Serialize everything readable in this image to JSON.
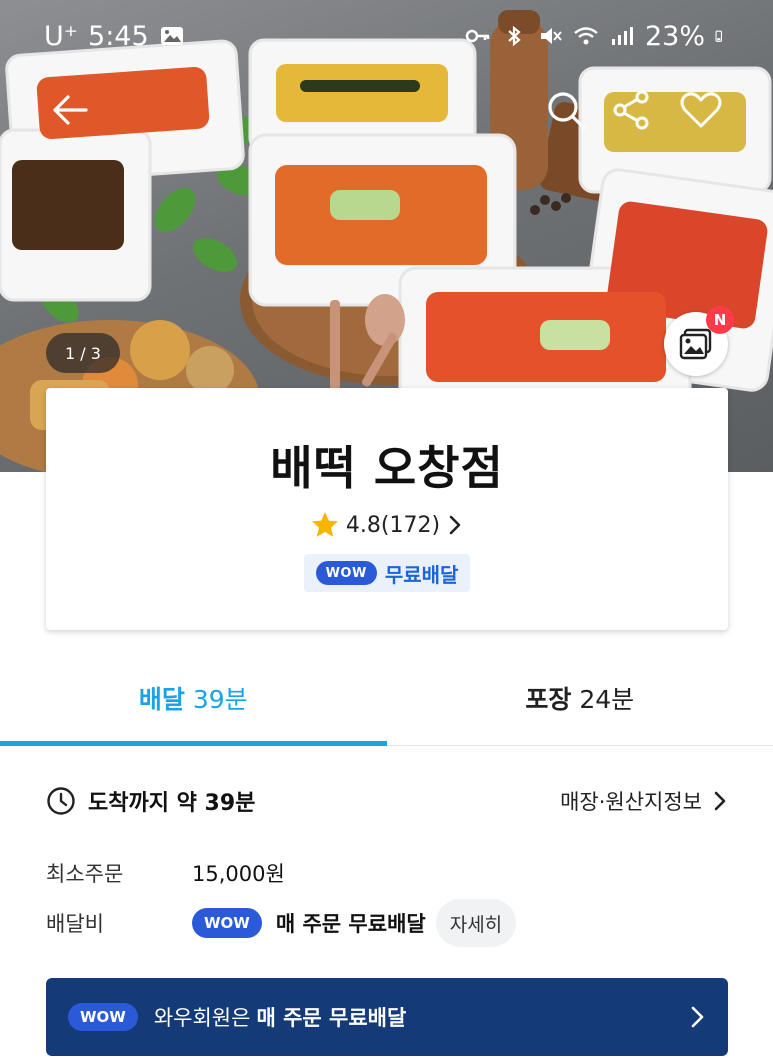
{
  "status_bar": {
    "carrier": "U⁺",
    "time": "5:45",
    "battery": "23%"
  },
  "hero": {
    "pager": "1 / 3",
    "photo_badge": "N"
  },
  "store": {
    "name": "배떡 오창점",
    "rating": "4.8(172)",
    "wow_label": "WOW",
    "free_delivery": "무료배달"
  },
  "tabs": [
    {
      "name": "배달",
      "time": "39분",
      "active": true
    },
    {
      "name": "포장",
      "time": "24분",
      "active": false
    }
  ],
  "arrival": {
    "text": "도착까지 약 39분",
    "origin_link": "매장·원산지정보"
  },
  "min_order": {
    "label": "최소주문",
    "value": "15,000원"
  },
  "delivery_fee": {
    "label": "배달비",
    "wow_label": "WOW",
    "value": "매 주문 무료배달",
    "detail_button": "자세히"
  },
  "wow_banner": {
    "wow_label": "WOW",
    "text": "와우회원은",
    "bold_text": "매 주문 무료배달"
  },
  "colors": {
    "accent": "#1aa3e8",
    "wow_blue": "#2a5ad8",
    "banner_navy": "#143a78"
  },
  "icons": [
    "back-arrow-icon",
    "search-icon",
    "share-icon",
    "heart-icon",
    "photo-review-icon",
    "star-icon",
    "chevron-right-icon",
    "clock-icon"
  ]
}
